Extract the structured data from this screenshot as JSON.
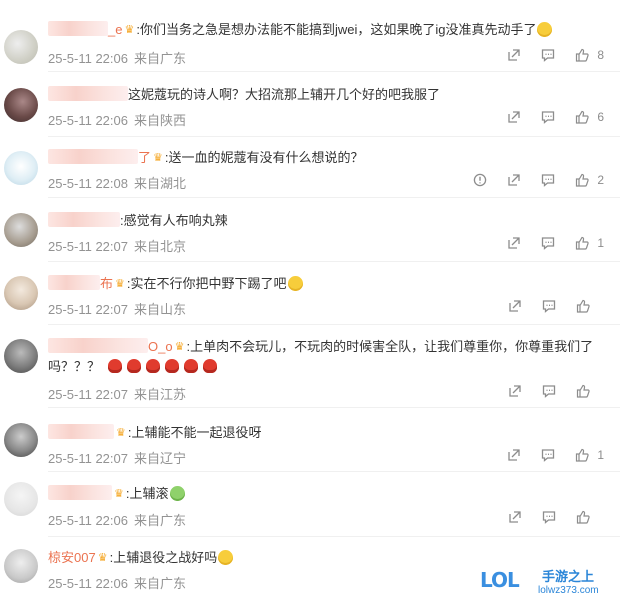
{
  "comments": [
    {
      "name_suffix": "_e",
      "text": ":你们当务之急是想办法能不能搞到jwei，这如果晚了ig没准真先动手了",
      "time": "25-5-11 22:06",
      "location": "来自广东",
      "likes": "8",
      "has_report": false
    },
    {
      "name_suffix": "",
      "text": "这妮蔻玩的诗人啊？大招流那上辅开几个好的吧我服了",
      "time": "25-5-11 22:06",
      "location": "来自陕西",
      "likes": "6",
      "has_report": false
    },
    {
      "name_suffix": "了",
      "text": ":送一血的妮蔻有没有什么想说的？",
      "time": "25-5-11 22:08",
      "location": "来自湖北",
      "likes": "2",
      "has_report": true
    },
    {
      "name_suffix": "",
      "text": ":感觉有人布响丸辣",
      "time": "25-5-11 22:07",
      "location": "来自北京",
      "likes": "1",
      "has_report": false
    },
    {
      "name_suffix": "布",
      "text": ":实在不行你把中野下踢了吧",
      "time": "25-5-11 22:07",
      "location": "来自山东",
      "likes": "",
      "has_report": false
    },
    {
      "name_suffix": "O_o",
      "text": ":上单肉不会玩儿，不玩肉的时候害全队，让我们尊重你，你尊重我们了吗？？？",
      "time": "25-5-11 22:07",
      "location": "来自江苏",
      "likes": "",
      "has_report": false
    },
    {
      "name_suffix": "",
      "text": ":上辅能不能一起退役呀",
      "time": "25-5-11 22:07",
      "location": "来自辽宁",
      "likes": "1",
      "has_report": false
    },
    {
      "name_suffix": "",
      "text": ":上辅滚",
      "time": "25-5-11 22:06",
      "location": "来自广东",
      "likes": "",
      "has_report": false
    },
    {
      "name": "椋安007",
      "text": ":上辅退役之战好吗",
      "time": "25-5-11 22:06",
      "location": "来自广东",
      "likes": "",
      "has_report": false
    }
  ],
  "watermark": {
    "logo": "LOL",
    "title": "手游之上",
    "url": "lolwz373.com"
  },
  "icons": [
    "share-icon",
    "comment-icon",
    "like-icon",
    "report-icon",
    "crown-icon"
  ]
}
